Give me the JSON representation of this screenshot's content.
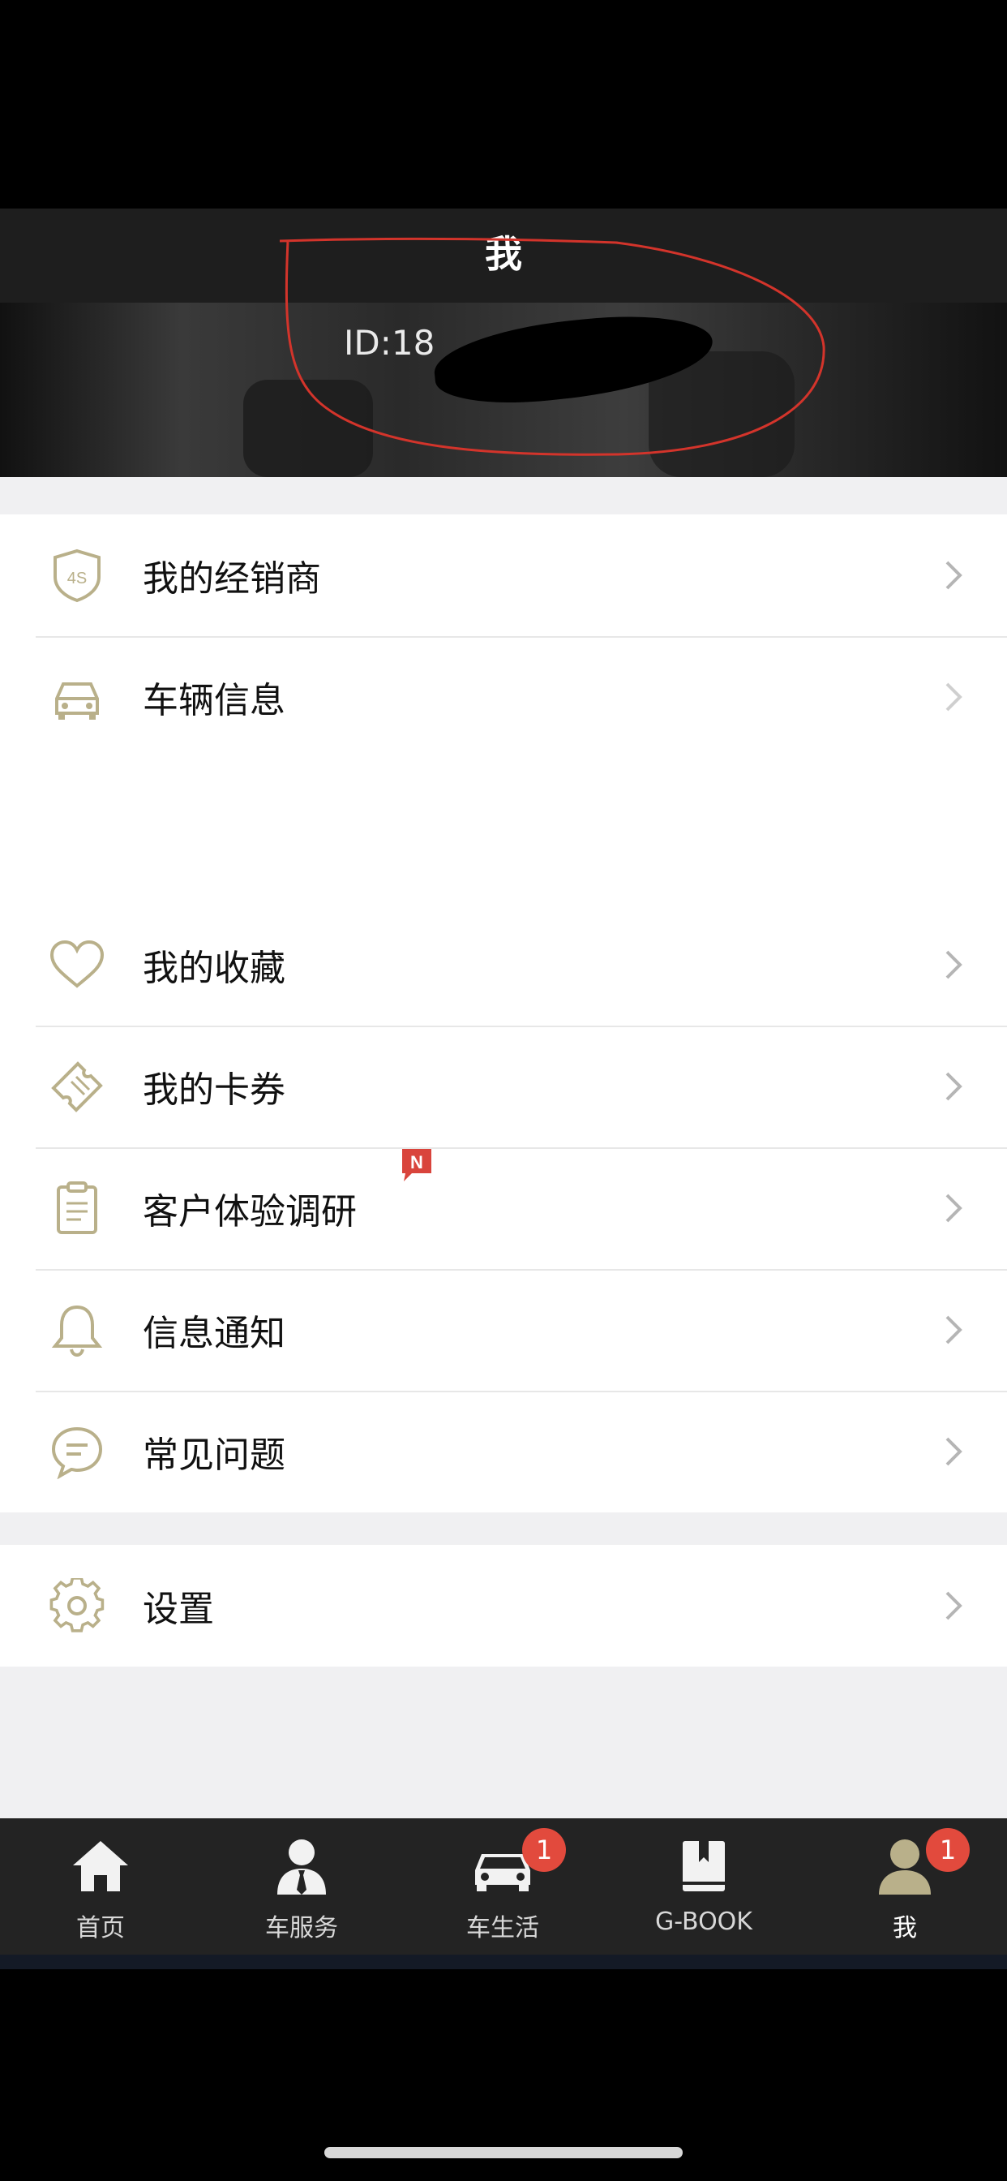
{
  "header": {
    "title": "我"
  },
  "profile": {
    "id_text": "ID:18"
  },
  "menu_group_1": [
    {
      "label": "我的经销商",
      "icon": "dealer-4s-shield-icon"
    },
    {
      "label": "车辆信息",
      "icon": "car-icon"
    }
  ],
  "menu_group_2": [
    {
      "label": "我的收藏",
      "icon": "heart-icon"
    },
    {
      "label": "我的卡券",
      "icon": "ticket-icon"
    },
    {
      "label": "客户体验调研",
      "icon": "clipboard-icon",
      "badge": "N"
    },
    {
      "label": "信息通知",
      "icon": "bell-icon"
    },
    {
      "label": "常见问题",
      "icon": "chat-bubble-icon"
    }
  ],
  "menu_group_3": [
    {
      "label": "设置",
      "icon": "gear-icon"
    }
  ],
  "tabs": [
    {
      "label": "首页",
      "icon": "home-icon"
    },
    {
      "label": "车服务",
      "icon": "service-person-icon"
    },
    {
      "label": "车生活",
      "icon": "car-icon",
      "badge": "1"
    },
    {
      "label": "G-BOOK",
      "icon": "book-icon"
    },
    {
      "label": "我",
      "icon": "user-icon",
      "badge": "1",
      "active": true
    }
  ],
  "colors": {
    "icon_accent": "#b9b08a",
    "badge_red": "#e24a3d",
    "tab_bar_bg": "#232323"
  }
}
